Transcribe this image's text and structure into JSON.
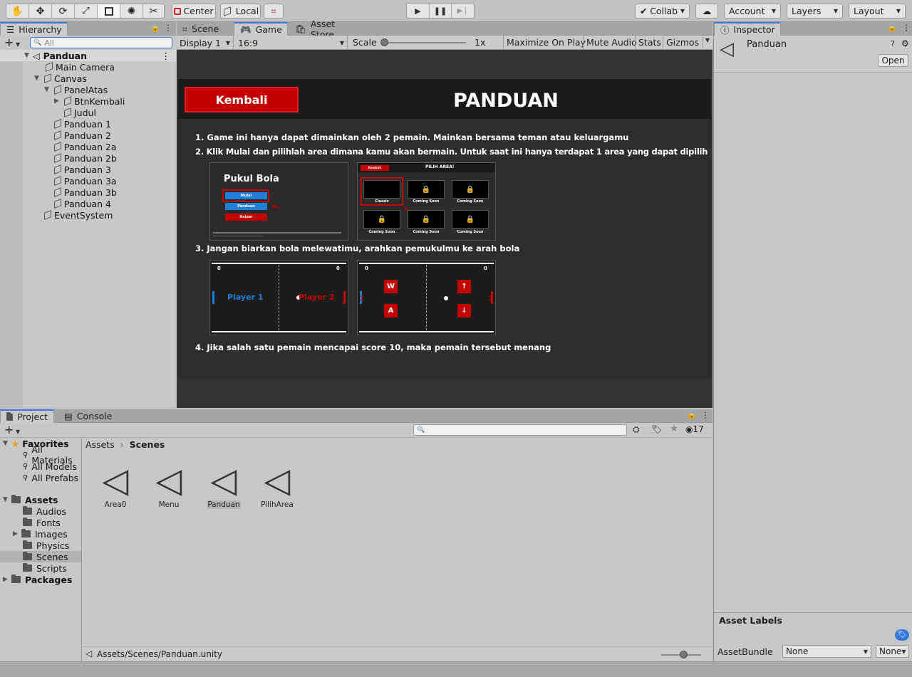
{
  "toolbar": {
    "center": "Center",
    "local": "Local",
    "collab": "Collab",
    "account": "Account",
    "layers": "Layers",
    "layout": "Layout"
  },
  "hierarchy": {
    "tab": "Hierarchy",
    "search_placeholder": "All",
    "scene": "Panduan",
    "items": [
      "Main Camera",
      "Canvas",
      "PanelAtas",
      "BtnKembali",
      "Judul",
      "Panduan 1",
      "Panduan 2",
      "Panduan 2a",
      "Panduan 2b",
      "Panduan 3",
      "Panduan 3a",
      "Panduan 3b",
      "Panduan 4",
      "EventSystem"
    ]
  },
  "game": {
    "tabs": [
      "Scene",
      "Game",
      "Asset Store"
    ],
    "display": "Display 1",
    "aspect": "16:9",
    "scale_label": "Scale",
    "scale_value": "1x",
    "maximize": "Maximize On Play",
    "mute": "Mute Audio",
    "stats": "Stats",
    "gizmos": "Gizmos",
    "back_button": "Kembali",
    "title": "PANDUAN",
    "step1": "1. Game ini hanya dapat dimainkan oleh 2 pemain. Mainkan bersama teman atau keluargamu",
    "step2": "2. Klik Mulai dan pilihlah area dimana kamu akan bermain. Untuk saat ini hanya terdapat 1 area yang dapat dipilih",
    "step3": "3. Jangan biarkan bola melewatimu, arahkan pemukulmu ke arah bola",
    "step4": "4. Jika salah satu pemain mencapai score 10, maka pemain tersebut menang",
    "menu_title": "Pukul Bola",
    "menu_btn1": "Mulai",
    "menu_btn2": "Panduan",
    "menu_btn3": "Keluar",
    "area_back": "Kembali",
    "area_title": "PILIH AREA!",
    "area_classic": "Classic",
    "area_soon": "Coming Soon",
    "player1": "Player 1",
    "player2": "Player 2",
    "score_left": "0",
    "score_right": "0",
    "key_w": "W",
    "key_a": "A",
    "key_up": "↑",
    "key_down": "↓"
  },
  "inspector": {
    "tab": "Inspector",
    "name": "Panduan",
    "open": "Open",
    "labels": "Asset Labels",
    "bundle_label": "AssetBundle",
    "bundle_value": "None",
    "variant_value": "None"
  },
  "project": {
    "tabs": [
      "Project",
      "Console"
    ],
    "hidden_count": "17",
    "breadcrumb_root": "Assets",
    "breadcrumb_current": "Scenes",
    "favorites": "Favorites",
    "fav_items": [
      "All Materials",
      "All Models",
      "All Prefabs"
    ],
    "assets": "Assets",
    "folders": [
      "Audios",
      "Fonts",
      "Images",
      "Physics",
      "Scenes",
      "Scripts"
    ],
    "packages": "Packages",
    "files": [
      "Area0",
      "Menu",
      "Panduan",
      "PilihArea"
    ],
    "path": "Assets/Scenes/Panduan.unity"
  },
  "colors": {
    "accent": "#3a79d8",
    "red": "#c40000",
    "blue": "#1f7fd6"
  }
}
